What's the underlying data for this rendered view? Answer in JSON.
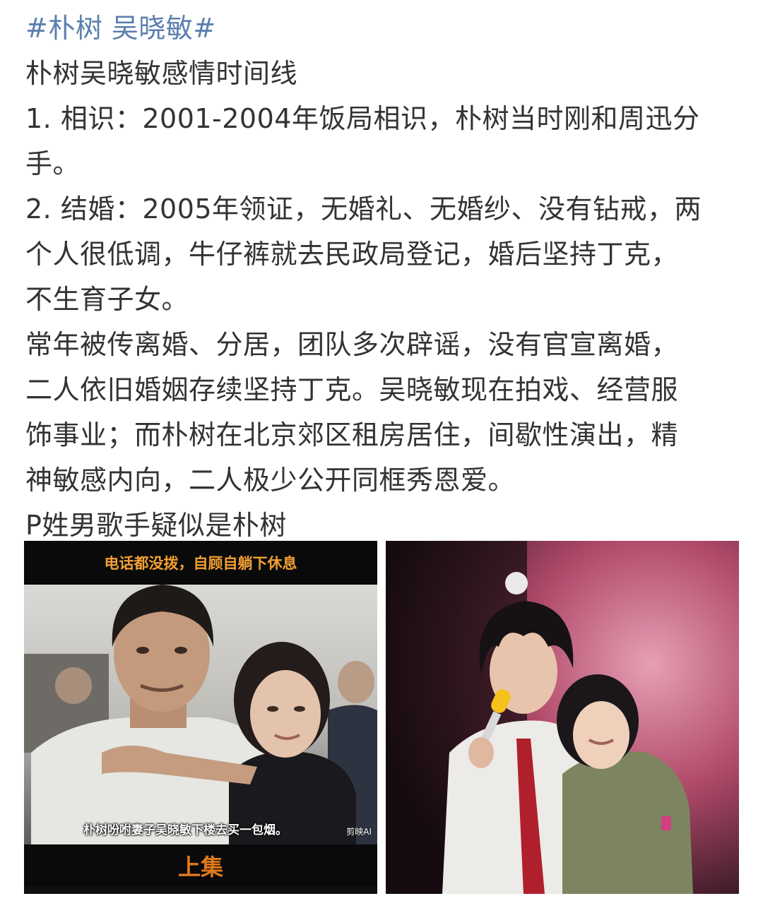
{
  "post": {
    "hashtag": "#朴树 吴晓敏#",
    "title": "朴树吴晓敏感情时间线",
    "lines": [
      "1. 相识：2001-2004年饭局相识，朴树当时刚和周迅分",
      "手。",
      "2. 结婚：2005年领证，无婚礼、无婚纱、没有钻戒，两",
      "个人很低调，牛仔裤就去民政局登记，婚后坚持丁克，",
      "不生育子女。",
      "常年被传离婚、分居，团队多次辟谣，没有官宣离婚，",
      "二人依旧婚姻存续坚持丁克。吴晓敏现在拍戏、经营服",
      "饰事业；而朴树在北京郊区租房居住，间歇性演出，精",
      "神敏感内向，二人极少公开同框秀恩爱。",
      "P姓男歌手疑似是朴树"
    ]
  },
  "images": {
    "left": {
      "top_caption": "电话都没拨，自顾自躺下休息",
      "subtitle": "朴树吩咐妻子吴晓敏下楼去买一包烟。",
      "watermark": "剪映AI",
      "bottom_caption": "上集"
    }
  },
  "colors": {
    "hashtag": "#5b7fae",
    "text": "#333333",
    "caption_top": "#f2a033",
    "caption_bottom": "#e07a1c"
  }
}
